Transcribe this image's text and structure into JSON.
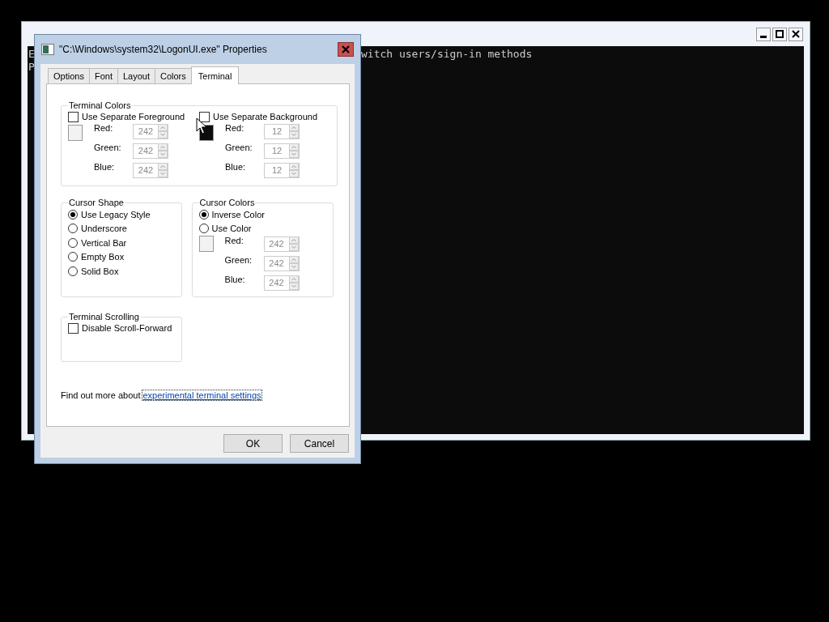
{
  "console_window": {
    "left_fragments": [
      "E",
      "P"
    ],
    "lines": [
      "witch users/sign-in methods"
    ],
    "buttons": [
      {
        "kind": "minimize"
      },
      {
        "kind": "maximize"
      },
      {
        "kind": "close"
      }
    ]
  },
  "dialog": {
    "title": "\"C:\\Windows\\system32\\LogonUI.exe\" Properties",
    "tabs": [
      {
        "label": "Options",
        "selected": false
      },
      {
        "label": "Font",
        "selected": false
      },
      {
        "label": "Layout",
        "selected": false
      },
      {
        "label": "Colors",
        "selected": false
      },
      {
        "label": "Terminal",
        "selected": true
      }
    ],
    "terminal_colors": {
      "title": "Terminal Colors",
      "columns": [
        {
          "label": "Use Separate Foreground",
          "checked": false,
          "fields": [
            {
              "label": "Red:",
              "value": "242",
              "disabled": true
            },
            {
              "label": "Green:",
              "value": "242",
              "disabled": true
            },
            {
              "label": "Blue:",
              "value": "242",
              "disabled": true
            }
          ]
        },
        {
          "label": "Use Separate Background",
          "checked": false,
          "fields": [
            {
              "label": "Red:",
              "value": "12",
              "disabled": true
            },
            {
              "label": "Green:",
              "value": "12",
              "disabled": true
            },
            {
              "label": "Blue:",
              "value": "12",
              "disabled": true
            }
          ]
        }
      ]
    },
    "cursor_shape": {
      "title": "Cursor Shape",
      "options": [
        {
          "label": "Use Legacy Style",
          "selected": true
        },
        {
          "label": "Underscore",
          "selected": false
        },
        {
          "label": "Vertical Bar",
          "selected": false
        },
        {
          "label": "Empty Box",
          "selected": false
        },
        {
          "label": "Solid Box",
          "selected": false
        }
      ]
    },
    "cursor_colors": {
      "title": "Cursor Colors",
      "options": [
        {
          "label": "Inverse Color",
          "selected": true
        },
        {
          "label": "Use Color",
          "selected": false
        }
      ],
      "fields": [
        {
          "label": "Red:",
          "value": "242",
          "disabled": true
        },
        {
          "label": "Green:",
          "value": "242",
          "disabled": true
        },
        {
          "label": "Blue:",
          "value": "242",
          "disabled": true
        }
      ]
    },
    "terminal_scrolling": {
      "title": "Terminal Scrolling",
      "options": [
        {
          "label": "Disable Scroll-Forward",
          "checked": false
        }
      ]
    },
    "footer": {
      "text": "Find out more about",
      "link": "experimental terminal settings"
    },
    "buttons": [
      "OK",
      "Cancel"
    ]
  }
}
